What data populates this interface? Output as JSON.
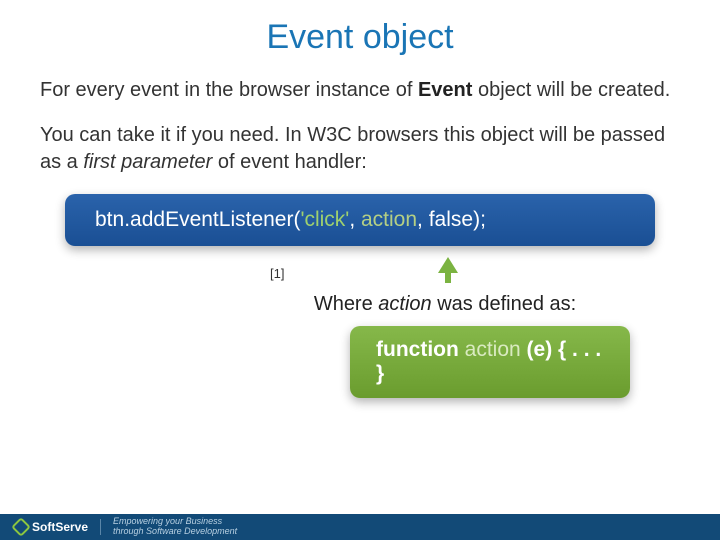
{
  "title": "Event object",
  "para1_pre": "For every event in the browser instance of ",
  "para1_strong": "Event",
  "para1_post": " object will be created.",
  "para2_pre": "You can take it if you need. In W3C browsers this object will be passed as a ",
  "para2_em": "first parameter",
  "para2_post": " of event handler:",
  "code1": {
    "a": "btn.addEventListener(",
    "b": "'click'",
    "c": ", ",
    "d": "action",
    "e": ", false);"
  },
  "refnum": "[1]",
  "subline_pre": "Where ",
  "subline_em": "action",
  "subline_post": " was defined as:",
  "code2": {
    "a": "function",
    "b": " action ",
    "c": "(e) { . . . }"
  },
  "footer": {
    "brand": "SoftServe",
    "tagline1": "Empowering your Business",
    "tagline2": "through Software Development"
  }
}
